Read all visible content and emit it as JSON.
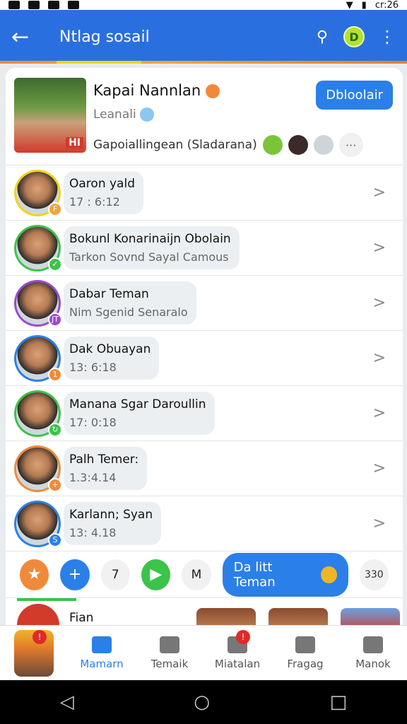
{
  "status_bar": {
    "time": "cr:26"
  },
  "app_bar": {
    "title": "Ntlag sosail"
  },
  "profile": {
    "name": "Kapai Nannlan",
    "subtitle": "Leanali",
    "description": "Gapoiallingean (Sladarana)",
    "tag": "HI",
    "action_label": "Dbloolair"
  },
  "rows": [
    {
      "name": "Oaron yald",
      "sub": "17 : 6:12",
      "ring": "#f3d21a",
      "mini": "#f0a43a",
      "mini_text": "F"
    },
    {
      "name": "Bokunl Konarinaijn Obolain",
      "sub": "Tarkon Sovnd Sayal Camous",
      "ring": "#3cc34a",
      "mini": "#3cc34a",
      "mini_text": "✓"
    },
    {
      "name": "Dabar Teman",
      "sub": "Nim Sgenid Senaralo",
      "ring": "#9c4ad0",
      "mini": "#9c4ad0",
      "mini_text": "JT"
    },
    {
      "name": "Dak Obuayan",
      "sub": "13: 6:18",
      "ring": "#2a80e8",
      "mini": "#f08a3a",
      "mini_text": "1"
    },
    {
      "name": "Manana Sgar Daroullin",
      "sub": "17: 0:18",
      "ring": "#3cc34a",
      "mini": "#3cc34a",
      "mini_text": "↻"
    },
    {
      "name": "Palh Temer:",
      "sub": "1.3:4.14",
      "ring": "#f08a3a",
      "mini": "#f08a3a",
      "mini_text": "+"
    },
    {
      "name": "Karlann; Syan",
      "sub": "13: 4.18",
      "ring": "#2a80e8",
      "mini": "#2a80e8",
      "mini_text": "S"
    }
  ],
  "actions": {
    "count_label": "7",
    "m_label": "M",
    "friend_label": "Da litt Teman",
    "total_label": "330"
  },
  "strip": {
    "name": "Fian"
  },
  "bottom_nav": [
    {
      "label": "",
      "badge": "!"
    },
    {
      "label": "Mamarn",
      "active": true
    },
    {
      "label": "Temaik"
    },
    {
      "label": "Miatalan",
      "badge": "!"
    },
    {
      "label": "Fragag"
    },
    {
      "label": "Manok"
    }
  ],
  "colors": {
    "primary": "#2a80e8",
    "app_bar": "#2a6fe0",
    "accent_orange": "#f08a3a",
    "accent_green": "#3cc34a"
  }
}
